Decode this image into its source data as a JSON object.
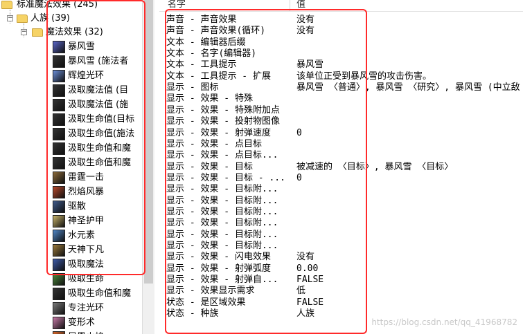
{
  "tree": {
    "root": {
      "label": "标准魔法效果 (245)"
    },
    "race": {
      "label": "人族 (39)"
    },
    "category": {
      "label": "魔法效果 (32)"
    },
    "items": [
      {
        "label": "暴风雪",
        "icon": "blizzard-icon",
        "color": "#5a66c8"
      },
      {
        "label": "暴风雪 (施法者",
        "icon": "generic-spell-icon",
        "color": "#333333"
      },
      {
        "label": "辉煌光环",
        "icon": "brilliance-aura-icon",
        "color": "#6b8ed8"
      },
      {
        "label": "汲取魔法值 (目",
        "icon": "generic-spell-icon",
        "color": "#333333"
      },
      {
        "label": "汲取魔法值 (施",
        "icon": "generic-spell-icon",
        "color": "#333333"
      },
      {
        "label": "汲取生命值(目标",
        "icon": "generic-spell-icon",
        "color": "#333333"
      },
      {
        "label": "汲取生命值(施法",
        "icon": "generic-spell-icon",
        "color": "#333333"
      },
      {
        "label": "汲取生命值和魔",
        "icon": "generic-spell-icon",
        "color": "#333333"
      },
      {
        "label": "汲取生命值和魔",
        "icon": "generic-spell-icon",
        "color": "#333333"
      },
      {
        "label": "雷霆一击",
        "icon": "thunderclap-icon",
        "color": "#8a6a3a"
      },
      {
        "label": "烈焰风暴",
        "icon": "flamestrike-icon",
        "color": "#b8482a"
      },
      {
        "label": "驱散",
        "icon": "dispel-icon",
        "color": "#3f5a8a"
      },
      {
        "label": "神圣护甲",
        "icon": "divine-shield-icon",
        "color": "#c9b46a"
      },
      {
        "label": "水元素",
        "icon": "water-elemental-icon",
        "color": "#4f86c6"
      },
      {
        "label": "天神下凡",
        "icon": "avatar-icon",
        "color": "#9c7b3c"
      },
      {
        "label": "吸取魔法",
        "icon": "siphon-mana-icon",
        "color": "#3c5aa8"
      },
      {
        "label": "吸取生命",
        "icon": "life-drain-icon",
        "color": "#4c8a3c"
      },
      {
        "label": "吸取生命值和魔",
        "icon": "generic-spell-icon",
        "color": "#333333"
      },
      {
        "label": "专注光环",
        "icon": "devotion-aura-icon",
        "color": "#7a7a7a"
      },
      {
        "label": "变形术",
        "icon": "polymorph-icon",
        "color": "#c87aa8"
      },
      {
        "label": "凤凰火焰",
        "icon": "phoenix-fire-icon",
        "color": "#d8662a"
      }
    ]
  },
  "table": {
    "headers": {
      "name": "名字",
      "value": "值"
    },
    "rows": [
      {
        "name": "声音 - 声音效果",
        "value": "没有"
      },
      {
        "name": "声音 - 声音效果(循环)",
        "value": "没有"
      },
      {
        "name": "文本 - 编辑器后缀",
        "value": ""
      },
      {
        "name": "文本 - 名字(编辑器)",
        "value": ""
      },
      {
        "name": "文本 - 工具提示",
        "value": "暴风雪"
      },
      {
        "name": "文本 - 工具提示 - 扩展",
        "value": "该单位正受到暴风雪的攻击伤害。"
      },
      {
        "name": "显示 - 图标",
        "value": "暴风雪 〈普通〉, 暴风雪 〈研究〉, 暴风雪 (中立敌"
      },
      {
        "name": "显示 - 效果 - 特殊",
        "value": ""
      },
      {
        "name": "显示 - 效果 - 特殊附加点",
        "value": ""
      },
      {
        "name": "显示 - 效果 - 投射物图像",
        "value": ""
      },
      {
        "name": "显示 - 效果 - 射弹速度",
        "value": "0"
      },
      {
        "name": "显示 - 效果 - 点目标",
        "value": ""
      },
      {
        "name": "显示 - 效果 - 点目标...",
        "value": ""
      },
      {
        "name": "显示 - 效果 - 目标",
        "value": "被减速的 〈目标〉, 暴风雪 〈目标〉"
      },
      {
        "name": "显示 - 效果 - 目标 - ...",
        "value": "0"
      },
      {
        "name": "显示 - 效果 - 目标附...",
        "value": ""
      },
      {
        "name": "显示 - 效果 - 目标附...",
        "value": ""
      },
      {
        "name": "显示 - 效果 - 目标附...",
        "value": ""
      },
      {
        "name": "显示 - 效果 - 目标附...",
        "value": ""
      },
      {
        "name": "显示 - 效果 - 目标附...",
        "value": ""
      },
      {
        "name": "显示 - 效果 - 目标附...",
        "value": ""
      },
      {
        "name": "显示 - 效果 - 闪电效果",
        "value": "没有"
      },
      {
        "name": "显示 - 效果 - 射弹弧度",
        "value": "0.00"
      },
      {
        "name": "显示 - 效果 - 射弹自...",
        "value": "FALSE"
      },
      {
        "name": "显示 - 效果显示需求",
        "value": "低"
      },
      {
        "name": "状态 - 是区域效果",
        "value": "FALSE"
      },
      {
        "name": "状态 - 种族",
        "value": "人族"
      }
    ]
  },
  "watermark": "https://blog.csdn.net/qq_41968782",
  "colors": {
    "highlight": "#ff2a2a",
    "folder": "#f6d366"
  }
}
